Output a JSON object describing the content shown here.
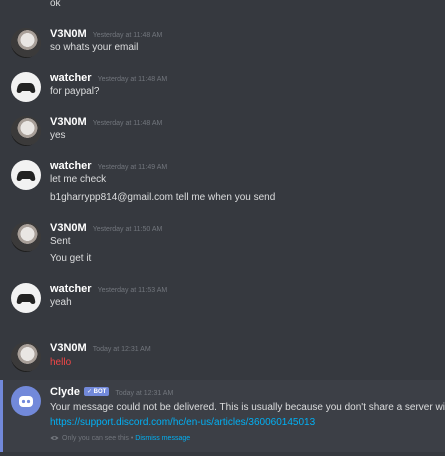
{
  "messages": [
    {
      "text": "ok"
    },
    {
      "author": "V3N0M",
      "timestamp": "Yesterday at 11:48 AM",
      "lines": [
        "so whats your email"
      ]
    },
    {
      "author": "watcher",
      "timestamp": "Yesterday at 11:48 AM",
      "lines": [
        "for paypal?"
      ]
    },
    {
      "author": "V3N0M",
      "timestamp": "Yesterday at 11:48 AM",
      "lines": [
        "yes"
      ]
    },
    {
      "author": "watcher",
      "timestamp": "Yesterday at 11:49 AM",
      "lines": [
        "let me check",
        "b1gharrypp814@gmail.com tell me when you send"
      ]
    },
    {
      "author": "V3N0M",
      "timestamp": "Yesterday at 11:50 AM",
      "lines": [
        "Sent",
        "You get it"
      ]
    },
    {
      "author": "watcher",
      "timestamp": "Yesterday at 11:53 AM",
      "lines": [
        "yeah"
      ]
    },
    {
      "author": "V3N0M",
      "timestamp": "Today at 12:31 AM",
      "lines": [
        "hello"
      ]
    }
  ],
  "clyde": {
    "author": "Clyde",
    "badge": "✓ BOT",
    "timestamp": "Today at 12:31 AM",
    "text": "Your message could not be delivered. This is usually because you don't share a server wi",
    "link": "https://support.discord.com/hc/en-us/articles/360060145013",
    "ephemeral_note": "Only you can see this",
    "separator": " • ",
    "dismiss": "Dismiss message"
  },
  "colors": {
    "background": "#36393f",
    "link": "#00b0f4",
    "error_text": "#f04747",
    "bot_badge": "#7289da"
  }
}
